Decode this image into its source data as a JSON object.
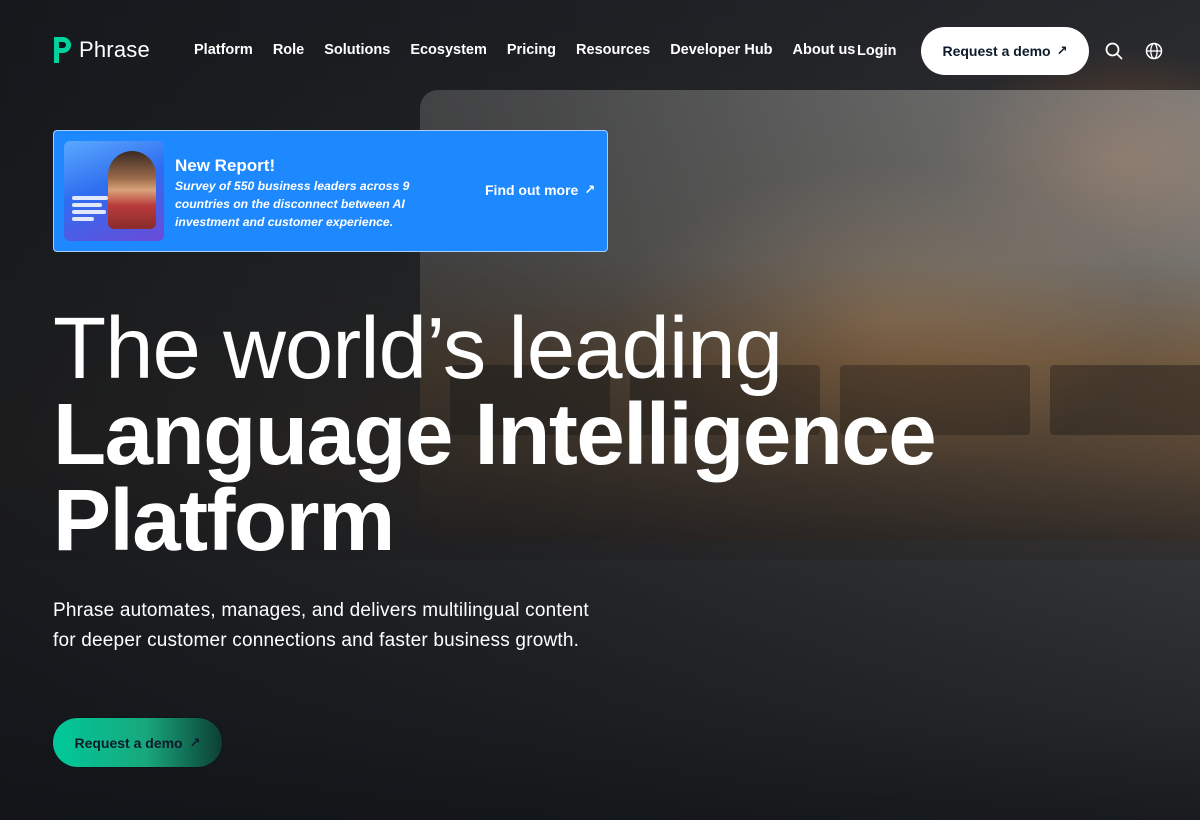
{
  "brand": {
    "name": "Phrase",
    "accent": "#1e88ff",
    "cta_gradient_start": "#00c99a"
  },
  "nav": {
    "items": [
      {
        "label": "Platform"
      },
      {
        "label": "Role"
      },
      {
        "label": "Solutions"
      },
      {
        "label": "Ecosystem"
      },
      {
        "label": "Pricing"
      },
      {
        "label": "Resources"
      },
      {
        "label": "Developer Hub"
      },
      {
        "label": "About us"
      }
    ],
    "login": "Login",
    "demo_button": "Request a demo",
    "demo_arrow": "↗",
    "icons": [
      "search-icon",
      "globe-icon"
    ]
  },
  "promo": {
    "title": "New Report!",
    "text": "Survey of 550 business leaders across 9 countries on the disconnect between AI investment and customer experience.",
    "link": "Find out more",
    "link_arrow": "↗"
  },
  "hero": {
    "line1": "The world’s leading",
    "line2": "Language Intelligence",
    "line3": "Platform",
    "subtitle": "Phrase automates, manages, and delivers multilingual content for deeper customer connections and faster business growth.",
    "cta": "Request a demo",
    "cta_arrow": "↗"
  }
}
